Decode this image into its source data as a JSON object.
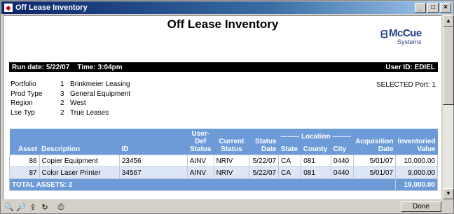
{
  "window": {
    "title": "Off Lease Inventory"
  },
  "report": {
    "title": "Off Lease Inventory",
    "logo": {
      "name": "McCue",
      "sub": "Systems"
    },
    "run_date": "Run date: 5/22/07",
    "run_time": "Time: 3:04pm",
    "user_id": "User ID: EDIEL",
    "selected_port": "SELECTED Port: 1",
    "params": [
      {
        "label": "Portfolio",
        "num": "1",
        "value": "Brinkmeier Leasing"
      },
      {
        "label": "Prod Type",
        "num": "3",
        "value": "General Equipment"
      },
      {
        "label": "Region",
        "num": "2",
        "value": "West"
      },
      {
        "label": "Lse Typ",
        "num": "2",
        "value": "True Leases"
      }
    ]
  },
  "table": {
    "headers": {
      "asset": "Asset",
      "description": "Description",
      "id": "ID",
      "user_def_status": "User-Def Status",
      "current_status": "Current Status",
      "status_date": "Status Date",
      "location": "-------- Location --------",
      "state": "State",
      "county": "County",
      "city": "City",
      "acq_date": "Acquisition Date",
      "inv_value": "Inventoried Value"
    },
    "rows": [
      {
        "asset": "86",
        "description": "Copier Equipment",
        "id": "23456",
        "user_def_status": "AINV",
        "current_status": "NRIV",
        "status_date": "5/22/07",
        "state": "CA",
        "county": "081",
        "city": "0440",
        "acq_date": "5/01/07",
        "inv_value": "10,000.00"
      },
      {
        "asset": "87",
        "description": "Color Laser Printer",
        "id": "34567",
        "user_def_status": "AINV",
        "current_status": "NRIV",
        "status_date": "5/22/07",
        "state": "CA",
        "county": "081",
        "city": "0440",
        "acq_date": "5/01/07",
        "inv_value": "9,000.00"
      }
    ],
    "total_label": "TOTAL ASSETS: 2",
    "total_value": "19,000.00"
  },
  "footer": {
    "done_label": "Done"
  }
}
